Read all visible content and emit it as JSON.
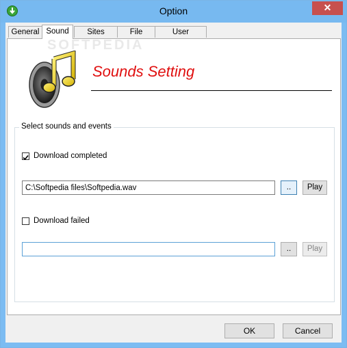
{
  "window": {
    "title": "Option",
    "close_glyph": "✕",
    "app_icon": "green-download-icon"
  },
  "tabs": [
    {
      "label": "General"
    },
    {
      "label": "Sound"
    },
    {
      "label": "Sites logins"
    },
    {
      "label": "File types"
    },
    {
      "label": "User interface"
    }
  ],
  "active_tab": "Sound",
  "header": {
    "heading": "Sounds Setting",
    "watermark": "SOFTPEDIA",
    "icon": "speaker-music-icon"
  },
  "group": {
    "label": "Select sounds and events",
    "events": [
      {
        "label": "Download completed",
        "checked": true,
        "path": "C:\\Softpedia files\\Softpedia.wav",
        "browse_label": "..",
        "play_label": "Play",
        "play_enabled": true
      },
      {
        "label": "Download failed",
        "checked": false,
        "path": "",
        "browse_label": "..",
        "play_label": "Play",
        "play_enabled": false
      }
    ]
  },
  "footer": {
    "ok_label": "OK",
    "cancel_label": "Cancel"
  },
  "colors": {
    "titlebar": "#77b9f0",
    "close_button": "#c7504e",
    "heading": "#e01010"
  }
}
